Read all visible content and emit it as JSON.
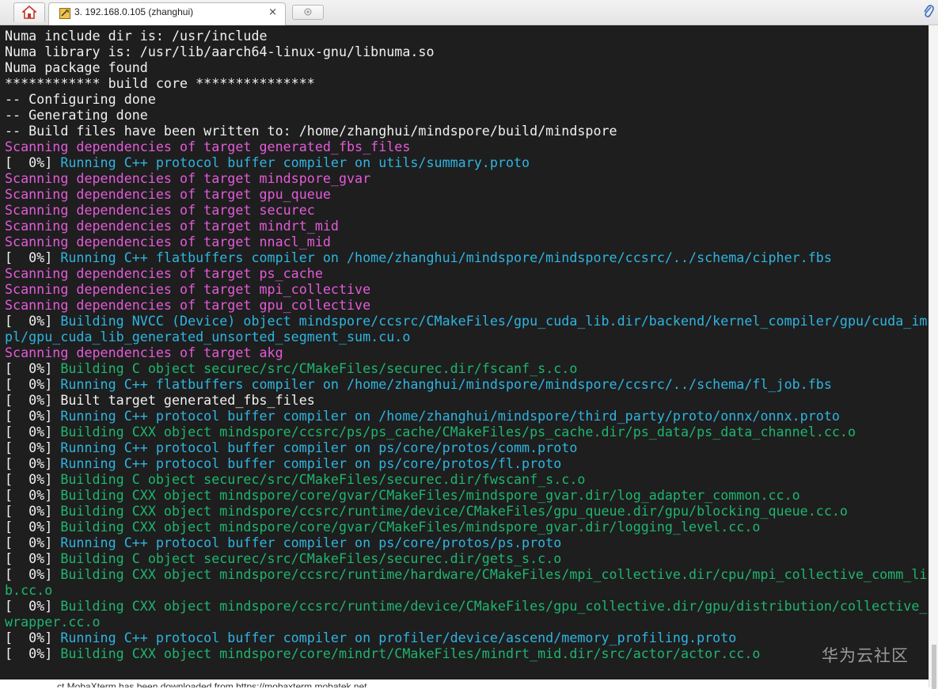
{
  "tab": {
    "title": "3. 192.168.0.105 (zhanghui)",
    "close": "×"
  },
  "icons": {
    "home": "home-icon",
    "terminal": "terminal-session-icon",
    "new_tab": "new-tab-icon",
    "attach": "paperclip-icon"
  },
  "colors": {
    "background": "#1e1e1e",
    "white": "#f0f0f0",
    "magenta": "#e35bd8",
    "blue": "#2fb4e0",
    "green": "#1fb56f"
  },
  "terminal": {
    "lines": [
      [
        [
          "w",
          "Numa include dir is: /usr/include"
        ]
      ],
      [
        [
          "w",
          "Numa library is: /usr/lib/aarch64-linux-gnu/libnuma.so"
        ]
      ],
      [
        [
          "w",
          "Numa package found"
        ]
      ],
      [
        [
          "w",
          "************ build core ***************"
        ]
      ],
      [
        [
          "w",
          "-- Configuring done"
        ]
      ],
      [
        [
          "w",
          "-- Generating done"
        ]
      ],
      [
        [
          "w",
          "-- Build files have been written to: /home/zhanghui/mindspore/build/mindspore"
        ]
      ],
      [
        [
          "m",
          "Scanning dependencies of target generated_fbs_files"
        ]
      ],
      [
        [
          "w",
          "[  0%] "
        ],
        [
          "b",
          "Running C++ protocol buffer compiler on utils/summary.proto"
        ]
      ],
      [
        [
          "m",
          "Scanning dependencies of target mindspore_gvar"
        ]
      ],
      [
        [
          "m",
          "Scanning dependencies of target gpu_queue"
        ]
      ],
      [
        [
          "m",
          "Scanning dependencies of target securec"
        ]
      ],
      [
        [
          "m",
          "Scanning dependencies of target mindrt_mid"
        ]
      ],
      [
        [
          "m",
          "Scanning dependencies of target nnacl_mid"
        ]
      ],
      [
        [
          "w",
          "[  0%] "
        ],
        [
          "b",
          "Running C++ flatbuffers compiler on /home/zhanghui/mindspore/mindspore/ccsrc/../schema/cipher.fbs"
        ]
      ],
      [
        [
          "m",
          "Scanning dependencies of target ps_cache"
        ]
      ],
      [
        [
          "m",
          "Scanning dependencies of target mpi_collective"
        ]
      ],
      [
        [
          "m",
          "Scanning dependencies of target gpu_collective"
        ]
      ],
      [
        [
          "w",
          "[  0%] "
        ],
        [
          "b",
          "Building NVCC (Device) object mindspore/ccsrc/CMakeFiles/gpu_cuda_lib.dir/backend/kernel_compiler/gpu/cuda_im"
        ]
      ],
      [
        [
          "b",
          "pl/gpu_cuda_lib_generated_unsorted_segment_sum.cu.o"
        ]
      ],
      [
        [
          "m",
          "Scanning dependencies of target akg"
        ]
      ],
      [
        [
          "w",
          "[  0%] "
        ],
        [
          "g",
          "Building C object securec/src/CMakeFiles/securec.dir/fscanf_s.c.o"
        ]
      ],
      [
        [
          "w",
          "[  0%] "
        ],
        [
          "b",
          "Running C++ flatbuffers compiler on /home/zhanghui/mindspore/mindspore/ccsrc/../schema/fl_job.fbs"
        ]
      ],
      [
        [
          "w",
          "[  0%] Built target generated_fbs_files"
        ]
      ],
      [
        [
          "w",
          "[  0%] "
        ],
        [
          "b",
          "Running C++ protocol buffer compiler on /home/zhanghui/mindspore/third_party/proto/onnx/onnx.proto"
        ]
      ],
      [
        [
          "w",
          "[  0%] "
        ],
        [
          "g",
          "Building CXX object mindspore/ccsrc/ps/ps_cache/CMakeFiles/ps_cache.dir/ps_data/ps_data_channel.cc.o"
        ]
      ],
      [
        [
          "w",
          "[  0%] "
        ],
        [
          "b",
          "Running C++ protocol buffer compiler on ps/core/protos/comm.proto"
        ]
      ],
      [
        [
          "w",
          "[  0%] "
        ],
        [
          "b",
          "Running C++ protocol buffer compiler on ps/core/protos/fl.proto"
        ]
      ],
      [
        [
          "w",
          "[  0%] "
        ],
        [
          "g",
          "Building C object securec/src/CMakeFiles/securec.dir/fwscanf_s.c.o"
        ]
      ],
      [
        [
          "w",
          "[  0%] "
        ],
        [
          "g",
          "Building CXX object mindspore/core/gvar/CMakeFiles/mindspore_gvar.dir/log_adapter_common.cc.o"
        ]
      ],
      [
        [
          "w",
          "[  0%] "
        ],
        [
          "g",
          "Building CXX object mindspore/ccsrc/runtime/device/CMakeFiles/gpu_queue.dir/gpu/blocking_queue.cc.o"
        ]
      ],
      [
        [
          "w",
          "[  0%] "
        ],
        [
          "g",
          "Building CXX object mindspore/core/gvar/CMakeFiles/mindspore_gvar.dir/logging_level.cc.o"
        ]
      ],
      [
        [
          "w",
          "[  0%] "
        ],
        [
          "b",
          "Running C++ protocol buffer compiler on ps/core/protos/ps.proto"
        ]
      ],
      [
        [
          "w",
          "[  0%] "
        ],
        [
          "g",
          "Building C object securec/src/CMakeFiles/securec.dir/gets_s.c.o"
        ]
      ],
      [
        [
          "w",
          "[  0%] "
        ],
        [
          "g",
          "Building CXX object mindspore/ccsrc/runtime/hardware/CMakeFiles/mpi_collective.dir/cpu/mpi_collective_comm_li"
        ]
      ],
      [
        [
          "g",
          "b.cc.o"
        ]
      ],
      [
        [
          "w",
          "[  0%] "
        ],
        [
          "g",
          "Building CXX object mindspore/ccsrc/runtime/device/CMakeFiles/gpu_collective.dir/gpu/distribution/collective_"
        ]
      ],
      [
        [
          "g",
          "wrapper.cc.o"
        ]
      ],
      [
        [
          "w",
          "[  0%] "
        ],
        [
          "b",
          "Running C++ protocol buffer compiler on profiler/device/ascend/memory_profiling.proto"
        ]
      ],
      [
        [
          "w",
          "[  0%] "
        ],
        [
          "g",
          "Building CXX object mindspore/core/mindrt/CMakeFiles/mindrt_mid.dir/src/actor/actor.cc.o"
        ]
      ]
    ]
  },
  "watermark": "华为云社区",
  "bottom_hint": "…ct MobaXterm has been downloaded from https://mobaxterm.mobatek.net"
}
